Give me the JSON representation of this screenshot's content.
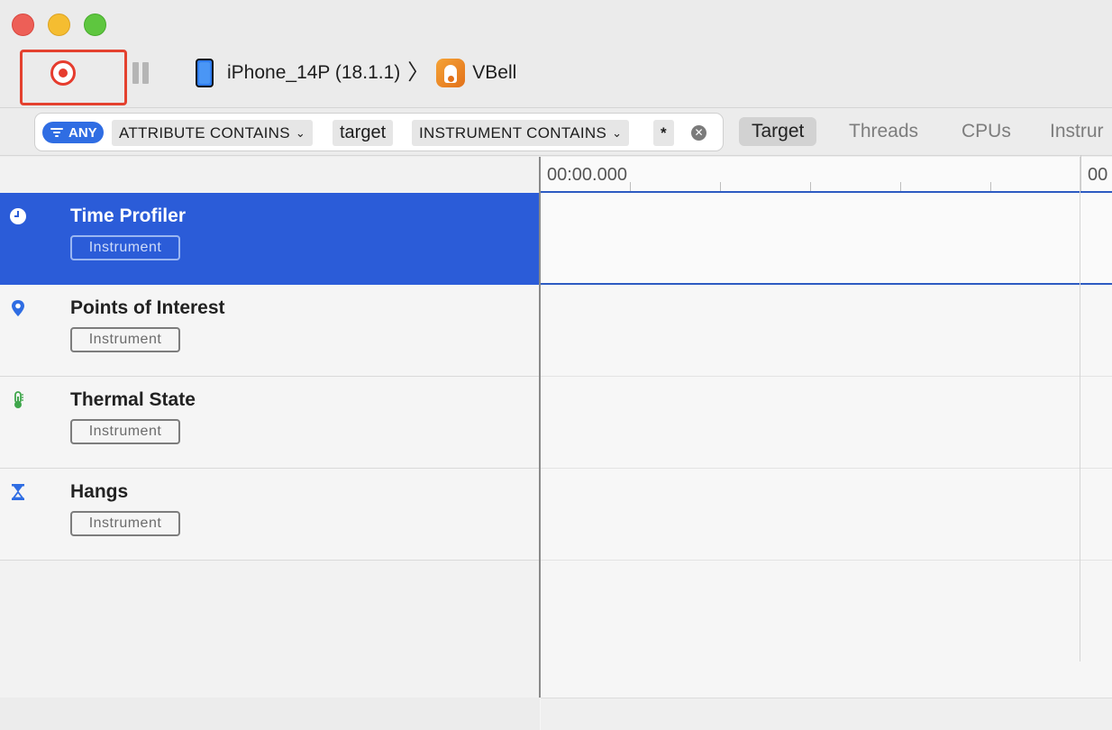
{
  "window": {
    "controls": [
      "close",
      "minimize",
      "maximize"
    ]
  },
  "toolbar": {
    "device_label": "iPhone_14P (18.1.1)",
    "separator": "〉",
    "app_label": "VBell",
    "record_icon": "record-icon",
    "pause_icon": "pause-icon",
    "accent_red": "#e63c2e"
  },
  "filter": {
    "scope_label": "ANY",
    "token1_label": "ATTRIBUTE CONTAINS",
    "token1_value": "target",
    "token2_label": "INSTRUMENT CONTAINS",
    "token2_value": "*",
    "clear_icon": "clear-icon"
  },
  "tabs": [
    {
      "label": "Target",
      "active": true
    },
    {
      "label": "Threads",
      "active": false
    },
    {
      "label": "CPUs",
      "active": false
    },
    {
      "label": "Instrur",
      "active": false
    }
  ],
  "timeline": {
    "start_label": "00:00.000",
    "next_label": "00"
  },
  "tracks": [
    {
      "title": "Time Profiler",
      "badge": "Instrument",
      "icon": "clock-icon",
      "selected": true
    },
    {
      "title": "Points of Interest",
      "badge": "Instrument",
      "icon": "location-pin-icon",
      "selected": false
    },
    {
      "title": "Thermal State",
      "badge": "Instrument",
      "icon": "thermometer-icon",
      "selected": false
    },
    {
      "title": "Hangs",
      "badge": "Instrument",
      "icon": "hourglass-icon",
      "selected": false
    }
  ],
  "colors": {
    "selection": "#2b5cd8",
    "filter_pill": "#2f6de3"
  }
}
